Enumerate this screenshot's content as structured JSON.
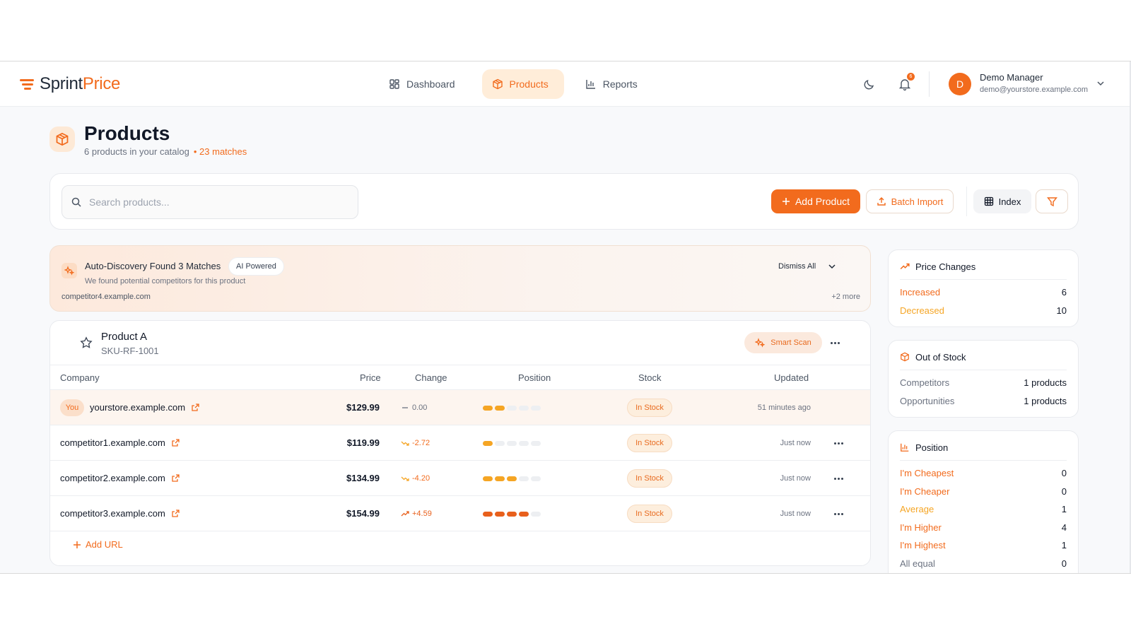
{
  "app": {
    "logo_part1": "Sprint",
    "logo_part2": "Price"
  },
  "nav": {
    "tabs": [
      {
        "label": "Dashboard",
        "icon": "dashboard-icon"
      },
      {
        "label": "Products",
        "icon": "box-icon",
        "active": true
      },
      {
        "label": "Reports",
        "icon": "bar-chart-icon"
      }
    ],
    "notification_count": "6"
  },
  "user": {
    "initial": "D",
    "name": "Demo Manager",
    "email": "demo@yourstore.example.com"
  },
  "page": {
    "title": "Products",
    "subtitle": "6 products in your catalog",
    "matches": "• 23 matches"
  },
  "toolbar": {
    "search_placeholder": "Search products...",
    "add_product": "Add Product",
    "batch_import": "Batch Import",
    "index": "Index"
  },
  "discovery": {
    "title": "Auto-Discovery Found 3 Matches",
    "badge": "AI Powered",
    "subtitle": "We found potential competitors for this product",
    "domain": "competitor4.example.com",
    "dismiss_all": "Dismiss All",
    "more": "+2 more"
  },
  "product": {
    "name": "Product A",
    "sku": "SKU-RF-1001",
    "smart_scan": "Smart Scan",
    "columns": [
      "Company",
      "Price",
      "Change",
      "Position",
      "Stock",
      "Updated"
    ],
    "you_label": "You",
    "rows": [
      {
        "company": "yourstore.example.com",
        "price": "$129.99",
        "change": "0.00",
        "trend": "flat",
        "position_level": 2,
        "position_color": "#f5a524",
        "stock": "In Stock",
        "updated": "51 minutes ago",
        "is_you": true
      },
      {
        "company": "competitor1.example.com",
        "price": "$119.99",
        "change": "-2.72",
        "trend": "down",
        "position_level": 1,
        "position_color": "#f5a524",
        "stock": "In Stock",
        "updated": "Just now"
      },
      {
        "company": "competitor2.example.com",
        "price": "$134.99",
        "change": "-4.20",
        "trend": "down",
        "position_level": 3,
        "position_color": "#f5a524",
        "stock": "In Stock",
        "updated": "Just now"
      },
      {
        "company": "competitor3.example.com",
        "price": "$154.99",
        "change": "+4.59",
        "trend": "up",
        "position_level": 4,
        "position_color": "#e8601c",
        "stock": "In Stock",
        "updated": "Just now"
      }
    ],
    "add_url": "Add URL"
  },
  "panels": {
    "price_changes": {
      "title": "Price Changes",
      "items": [
        {
          "label": "Increased",
          "value": "6"
        },
        {
          "label": "Decreased",
          "value": "10"
        }
      ]
    },
    "out_of_stock": {
      "title": "Out of Stock",
      "items": [
        {
          "label": "Competitors",
          "value": "1 products"
        },
        {
          "label": "Opportunities",
          "value": "1 products"
        }
      ]
    },
    "position": {
      "title": "Position",
      "items": [
        {
          "label": "I'm Cheapest",
          "value": "0"
        },
        {
          "label": "I'm Cheaper",
          "value": "0"
        },
        {
          "label": "Average",
          "value": "1",
          "color": "#f5a524"
        },
        {
          "label": "I'm Higher",
          "value": "4"
        },
        {
          "label": "I'm Highest",
          "value": "1"
        },
        {
          "label": "All equal",
          "value": "0",
          "muted": true
        }
      ]
    }
  },
  "colors": {
    "accent": "#f26b1d",
    "amber": "#f5a524"
  }
}
